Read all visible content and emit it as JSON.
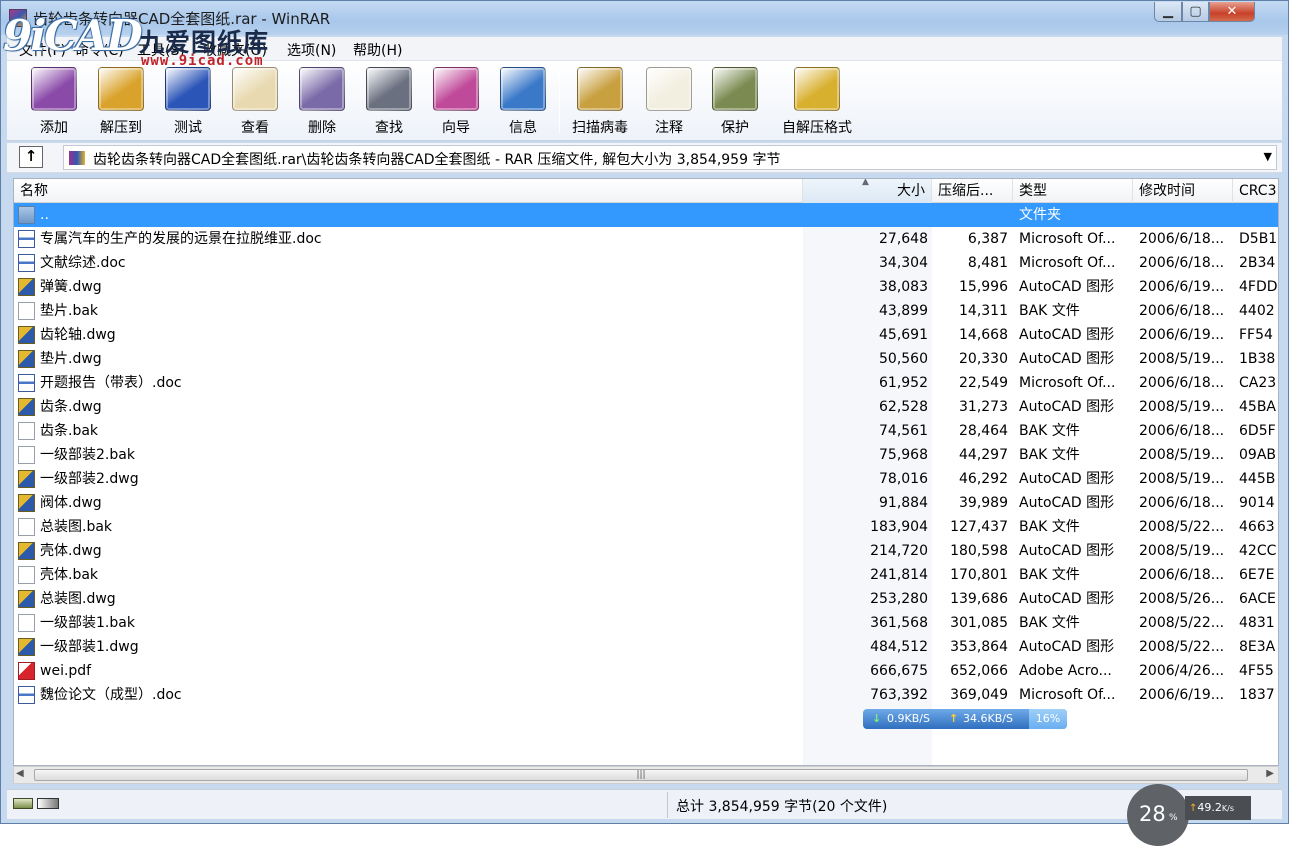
{
  "window": {
    "title": "齿轮齿条转向器CAD全套图纸.rar - WinRAR",
    "min_glyph": "▁",
    "max_glyph": "▢",
    "close_glyph": "✕"
  },
  "watermark": {
    "logo": "9iCAD",
    "name": "九爱图纸库",
    "url": "www.9icad.com"
  },
  "menu": [
    "文件(F)",
    "命令(C)",
    "工具(S)",
    "收藏夹(O)",
    "选项(N)",
    "帮助(H)"
  ],
  "toolbar": [
    {
      "label": "添加",
      "icon": "add-archive-icon",
      "color": "#8a4aa8"
    },
    {
      "label": "解压到",
      "icon": "extract-to-icon",
      "color": "#d9a22a"
    },
    {
      "label": "测试",
      "icon": "test-icon",
      "color": "#2c55b8"
    },
    {
      "label": "查看",
      "icon": "view-icon",
      "color": "#e8d9b0"
    },
    {
      "label": "删除",
      "icon": "delete-icon",
      "color": "#7a6aa8"
    },
    {
      "label": "查找",
      "icon": "find-icon",
      "color": "#6a7080"
    },
    {
      "label": "向导",
      "icon": "wizard-icon",
      "color": "#c04a9a"
    },
    {
      "label": "信息",
      "icon": "info-icon",
      "color": "#3a78c8"
    },
    {
      "label": "扫描病毒",
      "icon": "virus-scan-icon",
      "color": "#c8a040"
    },
    {
      "label": "注释",
      "icon": "comment-icon",
      "color": "#f2efe0"
    },
    {
      "label": "保护",
      "icon": "protect-icon",
      "color": "#7a8a50"
    },
    {
      "label": "自解压格式",
      "icon": "sfx-icon",
      "color": "#d8b030"
    }
  ],
  "address": {
    "up_glyph": "↑",
    "path": "齿轮齿条转向器CAD全套图纸.rar\\齿轮齿条转向器CAD全套图纸 - RAR 压缩文件, 解包大小为 3,854,959 字节",
    "dropdown_glyph": "▼"
  },
  "columns": {
    "name": "名称",
    "size": "大小",
    "packed": "压缩后...",
    "type": "类型",
    "modified": "修改时间",
    "crc": "CRC3"
  },
  "parent_row": {
    "name": "..",
    "type": "文件夹"
  },
  "files": [
    {
      "icon": "doc",
      "name": "专属汽车的生产的发展的远景在拉脱维亚.doc",
      "size": "27,648",
      "packed": "6,387",
      "type": "Microsoft Of...",
      "modified": "2006/6/18...",
      "crc": "D5B1"
    },
    {
      "icon": "doc",
      "name": "文献综述.doc",
      "size": "34,304",
      "packed": "8,481",
      "type": "Microsoft Of...",
      "modified": "2006/6/18...",
      "crc": "2B34"
    },
    {
      "icon": "dwg",
      "name": "弹簧.dwg",
      "size": "38,083",
      "packed": "15,996",
      "type": "AutoCAD 图形",
      "modified": "2006/6/19...",
      "crc": "4FDD"
    },
    {
      "icon": "bak",
      "name": "垫片.bak",
      "size": "43,899",
      "packed": "14,311",
      "type": "BAK 文件",
      "modified": "2006/6/18...",
      "crc": "4402"
    },
    {
      "icon": "dwg",
      "name": "齿轮轴.dwg",
      "size": "45,691",
      "packed": "14,668",
      "type": "AutoCAD 图形",
      "modified": "2006/6/19...",
      "crc": "FF54"
    },
    {
      "icon": "dwg",
      "name": "垫片.dwg",
      "size": "50,560",
      "packed": "20,330",
      "type": "AutoCAD 图形",
      "modified": "2008/5/19...",
      "crc": "1B38"
    },
    {
      "icon": "doc",
      "name": "开题报告（带表）.doc",
      "size": "61,952",
      "packed": "22,549",
      "type": "Microsoft Of...",
      "modified": "2006/6/18...",
      "crc": "CA23"
    },
    {
      "icon": "dwg",
      "name": "齿条.dwg",
      "size": "62,528",
      "packed": "31,273",
      "type": "AutoCAD 图形",
      "modified": "2008/5/19...",
      "crc": "45BA"
    },
    {
      "icon": "bak",
      "name": "齿条.bak",
      "size": "74,561",
      "packed": "28,464",
      "type": "BAK 文件",
      "modified": "2006/6/18...",
      "crc": "6D5F"
    },
    {
      "icon": "bak",
      "name": "一级部装2.bak",
      "size": "75,968",
      "packed": "44,297",
      "type": "BAK 文件",
      "modified": "2008/5/19...",
      "crc": "09AB"
    },
    {
      "icon": "dwg",
      "name": "一级部装2.dwg",
      "size": "78,016",
      "packed": "46,292",
      "type": "AutoCAD 图形",
      "modified": "2008/5/19...",
      "crc": "445B"
    },
    {
      "icon": "dwg",
      "name": "阀体.dwg",
      "size": "91,884",
      "packed": "39,989",
      "type": "AutoCAD 图形",
      "modified": "2006/6/18...",
      "crc": "9014"
    },
    {
      "icon": "bak",
      "name": "总装图.bak",
      "size": "183,904",
      "packed": "127,437",
      "type": "BAK 文件",
      "modified": "2008/5/22...",
      "crc": "4663"
    },
    {
      "icon": "dwg",
      "name": "壳体.dwg",
      "size": "214,720",
      "packed": "180,598",
      "type": "AutoCAD 图形",
      "modified": "2008/5/19...",
      "crc": "42CC"
    },
    {
      "icon": "bak",
      "name": "壳体.bak",
      "size": "241,814",
      "packed": "170,801",
      "type": "BAK 文件",
      "modified": "2006/6/18...",
      "crc": "6E7E"
    },
    {
      "icon": "dwg",
      "name": "总装图.dwg",
      "size": "253,280",
      "packed": "139,686",
      "type": "AutoCAD 图形",
      "modified": "2008/5/26...",
      "crc": "6ACE"
    },
    {
      "icon": "bak",
      "name": "一级部装1.bak",
      "size": "361,568",
      "packed": "301,085",
      "type": "BAK 文件",
      "modified": "2008/5/22...",
      "crc": "4831"
    },
    {
      "icon": "dwg",
      "name": "一级部装1.dwg",
      "size": "484,512",
      "packed": "353,864",
      "type": "AutoCAD 图形",
      "modified": "2008/5/22...",
      "crc": "8E3A"
    },
    {
      "icon": "pdf",
      "name": "wei.pdf",
      "size": "666,675",
      "packed": "652,066",
      "type": "Adobe Acro...",
      "modified": "2006/4/26...",
      "crc": "4F55"
    },
    {
      "icon": "doc",
      "name": "魏俭论文（成型）.doc",
      "size": "763,392",
      "packed": "369,049",
      "type": "Microsoft Of...",
      "modified": "2006/6/19...",
      "crc": "1837"
    }
  ],
  "speed_badge": {
    "down": "0.9KB/S",
    "up": "34.6KB/S",
    "pct": "16%",
    "down_glyph": "↓",
    "up_glyph": "↑"
  },
  "scrollbar": {
    "left_glyph": "◀",
    "right_glyph": "▶",
    "grip": "|||"
  },
  "status": {
    "total": "总计 3,854,959 字节(20 个文件)"
  },
  "net_widget": {
    "value": "28",
    "unit": "%",
    "up_glyph": "↑",
    "rate": "49.2",
    "rate_unit": "K/s"
  }
}
